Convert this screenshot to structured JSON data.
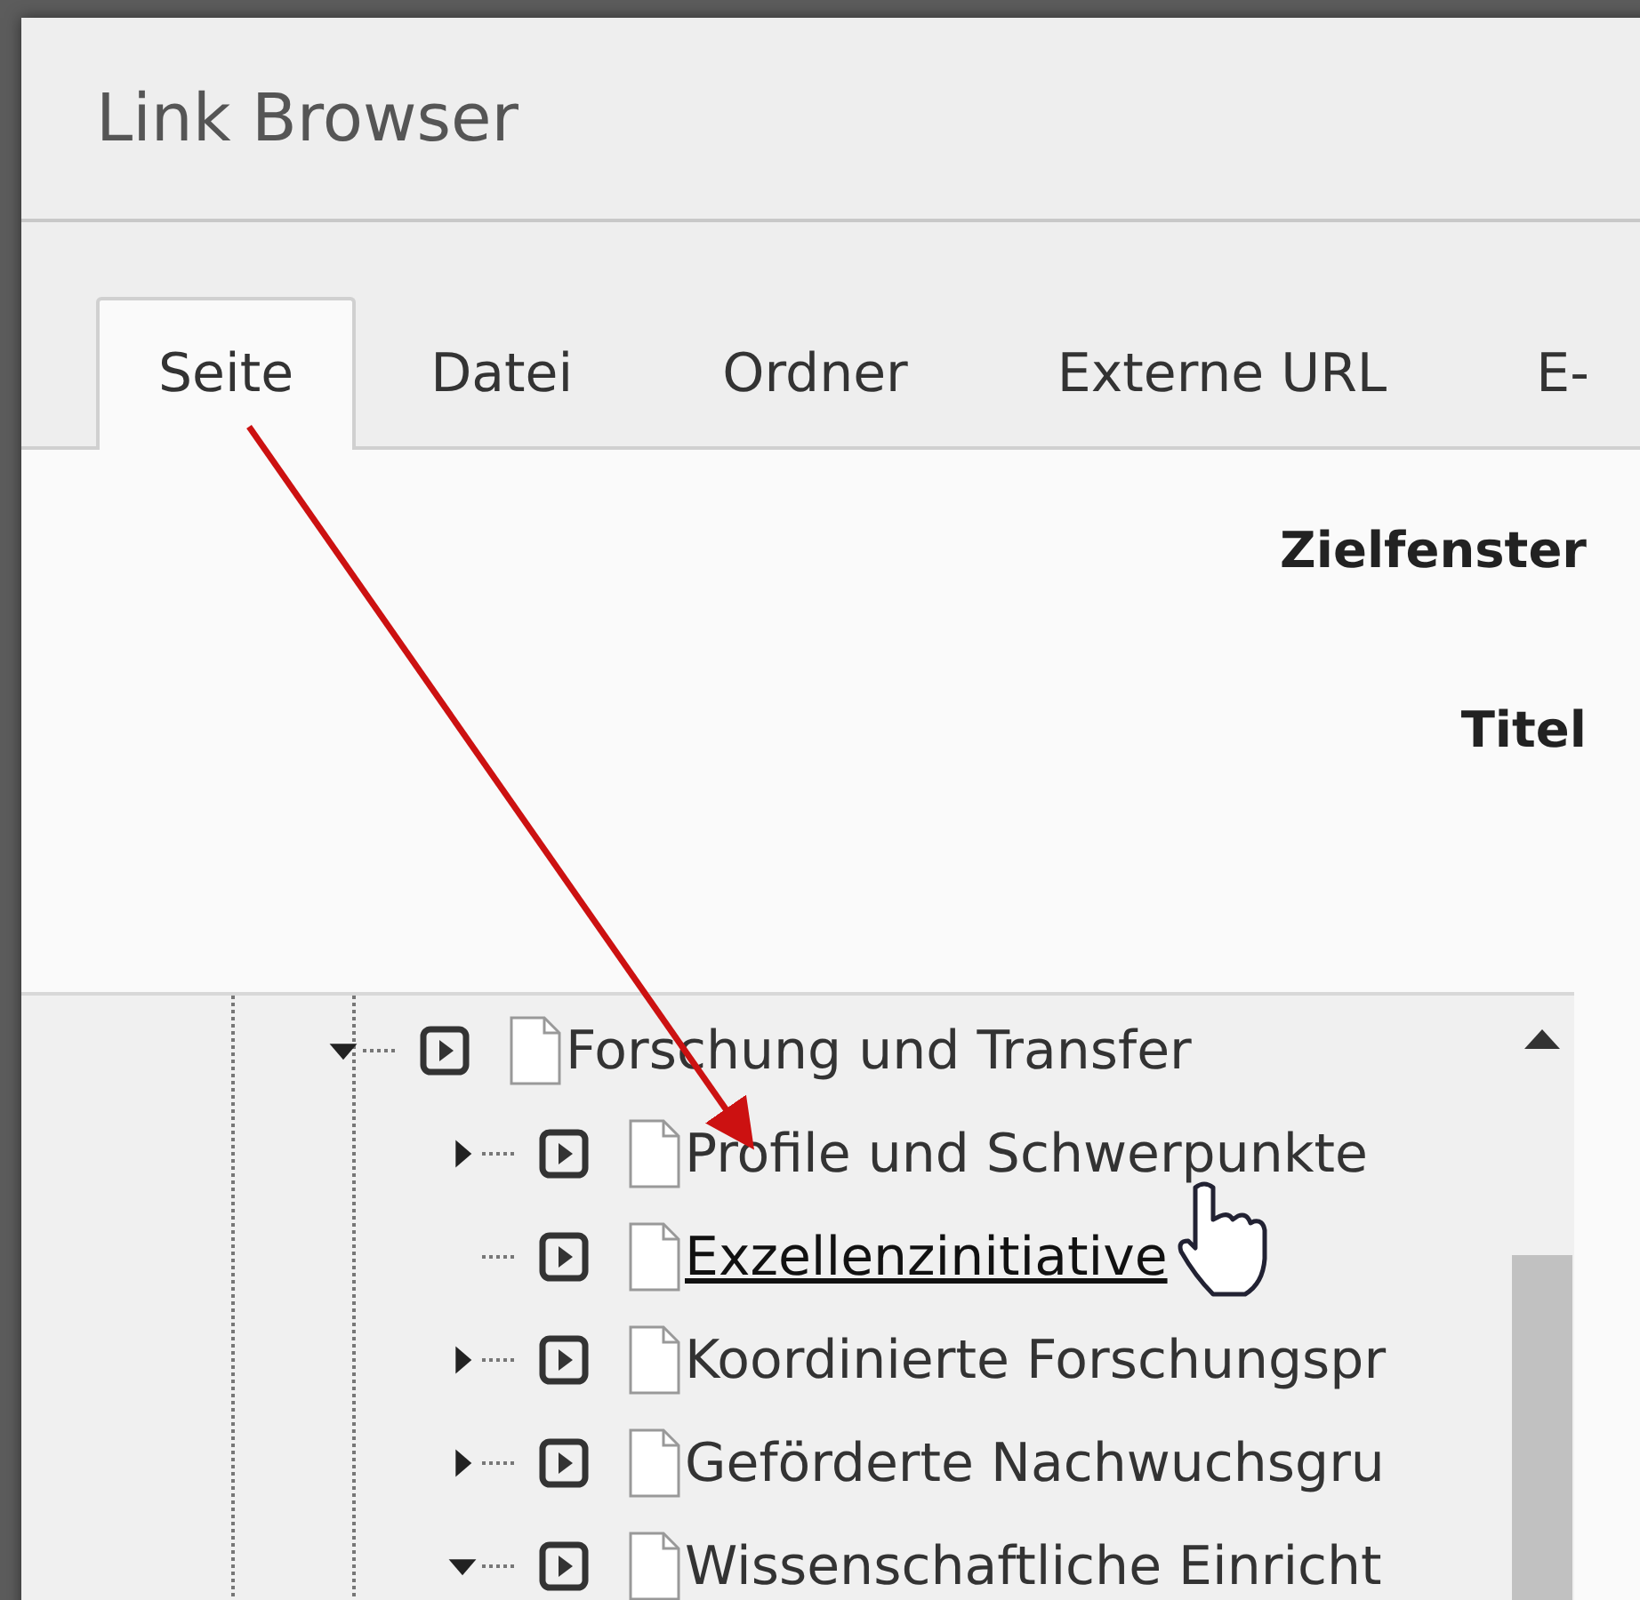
{
  "window": {
    "title": "Link Browser"
  },
  "tabs": [
    {
      "label": "Seite",
      "selected": true
    },
    {
      "label": "Datei",
      "selected": false
    },
    {
      "label": "Ordner",
      "selected": false
    },
    {
      "label": "Externe URL",
      "selected": false
    },
    {
      "label": "E-",
      "selected": false
    }
  ],
  "form": {
    "fields": [
      {
        "label": "Zielfenster"
      },
      {
        "label": "Titel"
      }
    ]
  },
  "tree": [
    {
      "label": "Forschung und Transfer",
      "kind": "branch",
      "expanded": true,
      "hovered": false,
      "children": [
        {
          "label": "Profile und Schwerpunkte",
          "kind": "branch",
          "expanded": false,
          "hovered": false
        },
        {
          "label": "Exzellenzinitiative",
          "kind": "leaf",
          "hovered": true
        },
        {
          "label": "Koordinierte Forschungspr",
          "kind": "branch",
          "expanded": false,
          "hovered": false
        },
        {
          "label": "Geförderte Nachwuchsgru",
          "kind": "branch",
          "expanded": false,
          "hovered": false
        },
        {
          "label": "Wissenschaftliche Einricht",
          "kind": "branch",
          "expanded": true,
          "hovered": false
        }
      ]
    }
  ]
}
